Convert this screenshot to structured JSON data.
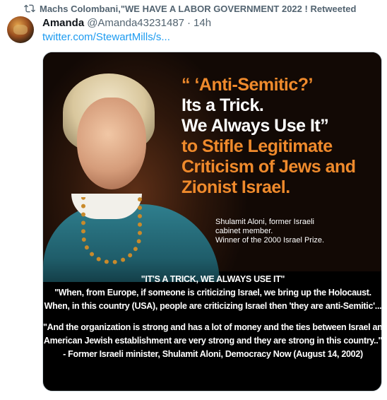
{
  "retweet": {
    "icon": "retweet-icon",
    "label": "Machs Colombani,\"WE HAVE A LABOR GOVERNMENT 2022 ! Retweeted"
  },
  "tweet": {
    "author_name": "Amanda",
    "author_handle": "@Amanda43231487",
    "separator": "·",
    "time": "14h",
    "link_text": "twitter.com/StewartMills/s..."
  },
  "image": {
    "quote_lines": [
      "“ ‘Anti-Semitic?’",
      "Its a Trick.",
      "We Always Use It”",
      "to Stifle Legitimate",
      "Criticism of Jews and",
      "Zionist Israel."
    ],
    "credit_lines": [
      "Shulamit Aloni, former Israeli",
      "cabinet member.",
      "Winner of the 2000 Israel Prize."
    ],
    "caption_lines": [
      "\"IT'S A TRICK,  WE ALWAYS USE IT\"",
      "\"When,  from Europe,  if someone is criticizing Israel,  we bring up the Holocaust.",
      "When,  in this country (USA),  people are criticizing Israel then 'they are anti-Semitic'...",
      "\"And the organization is strong and  has a lot of money  and the ties between Israel and the",
      "American Jewish establishment are very strong and they are strong in this country..\"",
      "- Former Israeli minister, Shulamit Aloni,  Democracy Now (August 14, 2002)"
    ]
  },
  "colors": {
    "accent_link": "#1d9bf0",
    "quote_orange": "#ef8a2c",
    "muted_text": "#536471"
  }
}
